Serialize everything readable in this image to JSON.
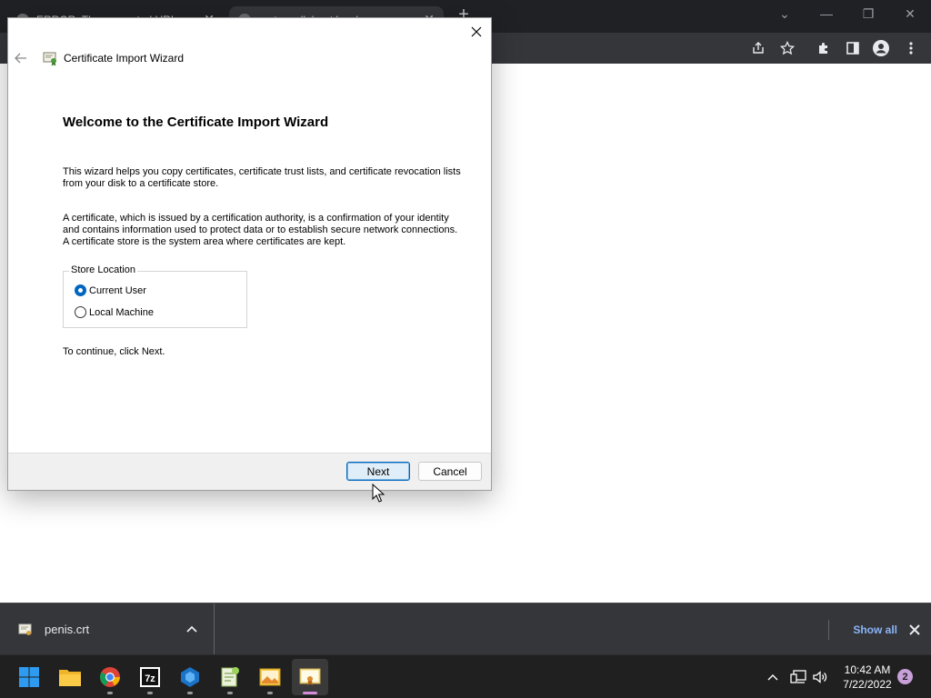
{
  "browser": {
    "tabs": [
      {
        "title": "ERROR: The requested URL cou",
        "close": "✕"
      },
      {
        "title": "router.collabnet.local",
        "close": "✕"
      }
    ],
    "new_tab": "+",
    "window_controls": {
      "tab_search": "⌄",
      "minimize": "—",
      "restore": "❐",
      "close": "✕"
    },
    "toolbar_icons": [
      "share-icon",
      "star-icon",
      "extensions-icon",
      "sidepanel-icon",
      "profile-icon",
      "menu-icon"
    ]
  },
  "dialog": {
    "close_label": "✕",
    "title": "Certificate Import Wizard",
    "heading": "Welcome to the Certificate Import Wizard",
    "para1": "This wizard helps you copy certificates, certificate trust lists, and certificate revocation lists from your disk to a certificate store.",
    "para2": "A certificate, which is issued by a certification authority, is a confirmation of your identity and contains information used to protect data or to establish secure network connections. A certificate store is the system area where certificates are kept.",
    "store_location": {
      "legend": "Store Location",
      "options": [
        {
          "label": "Current User",
          "checked": true
        },
        {
          "label": "Local Machine",
          "checked": false
        }
      ]
    },
    "continue_text": "To continue, click Next.",
    "buttons": {
      "next": "Next",
      "cancel": "Cancel"
    },
    "accent_color": "#0067c0"
  },
  "downloads": {
    "filename": "penis.crt",
    "show_all": "Show all"
  },
  "taskbar": {
    "apps": [
      "start-icon",
      "file-explorer-icon",
      "chrome-icon",
      "7zip-icon",
      "app-icon",
      "notepadpp-icon",
      "gallery-icon",
      "certificate-manager-icon"
    ],
    "time": "10:42 AM",
    "date": "7/22/2022",
    "notification_count": "2"
  }
}
